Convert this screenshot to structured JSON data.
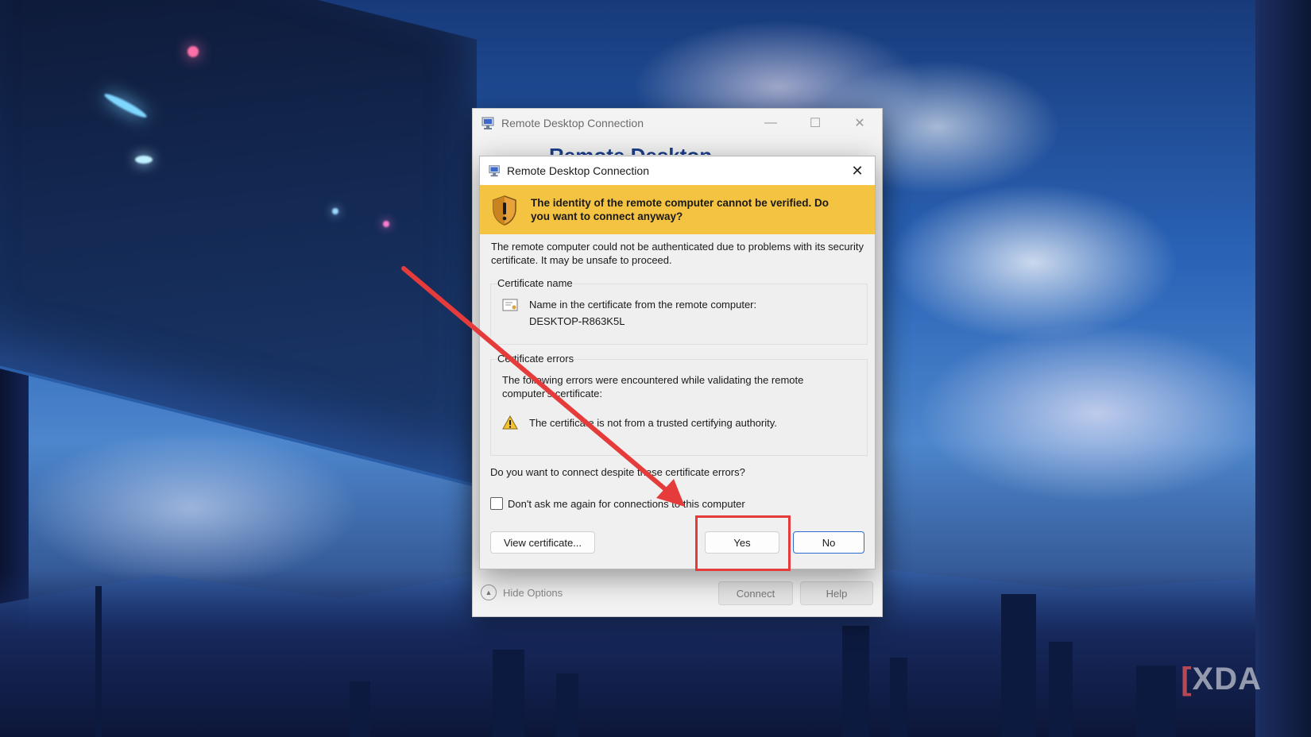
{
  "main_window": {
    "title": "Remote Desktop Connection",
    "banner_peek_text": "Remote Desktop",
    "footer": {
      "hide_options_label": "Hide Options",
      "connect_label": "Connect",
      "help_label": "Help"
    },
    "controls": {
      "minimize_glyph": "—",
      "maximize_glyph": "☐",
      "close_glyph": "✕"
    }
  },
  "dialog": {
    "title": "Remote Desktop Connection",
    "close_glyph": "✕",
    "warning_heading": "The identity of the remote computer cannot be verified. Do you want to connect anyway?",
    "intro": "The remote computer could not be authenticated due to problems with its security certificate. It may be unsafe to proceed.",
    "certificate_name": {
      "label": "Certificate name",
      "line1": "Name in the certificate from the remote computer:",
      "line2": "DESKTOP-R863K5L"
    },
    "certificate_errors": {
      "label": "Certificate errors",
      "description": "The following errors were encountered while validating the remote computer's certificate:",
      "item": "The certificate is not from a trusted certifying authority."
    },
    "question": "Do you want to connect despite these certificate errors?",
    "checkbox": {
      "label": "Don't ask me again for connections to this computer",
      "checked": false
    },
    "buttons": {
      "view_certificate": "View certificate...",
      "yes": "Yes",
      "no": "No"
    }
  },
  "watermark": {
    "bracket": "[",
    "text": "XDA"
  },
  "colors": {
    "warning_banner": "#f5c342",
    "annotation_red": "#e53b3b",
    "default_button_border": "#2d6bd0"
  },
  "icons": [
    "rdc-app-icon",
    "shield-warning-icon",
    "certificate-icon",
    "warning-triangle-icon",
    "chevron-up-icon",
    "close-icon"
  ]
}
